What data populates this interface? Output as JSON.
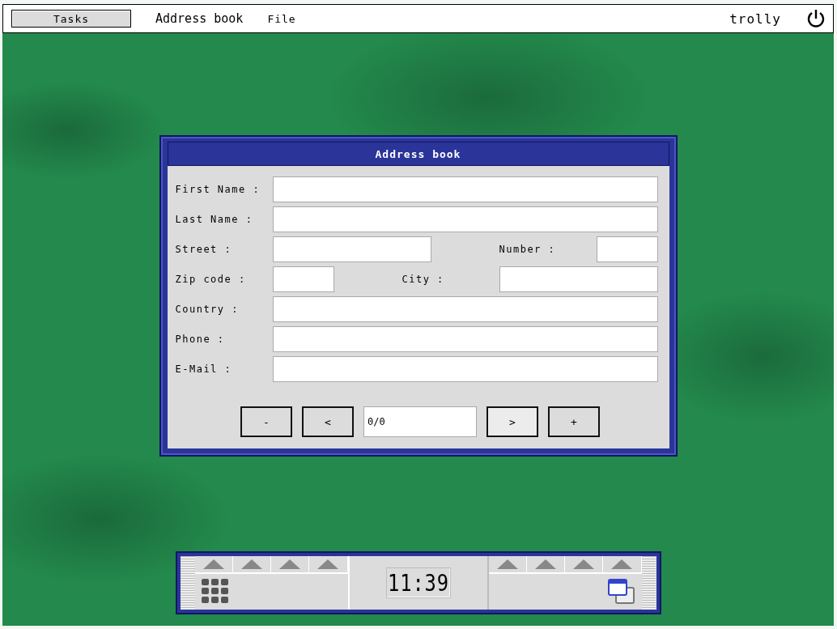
{
  "menu_bar": {
    "tasks_button": "Tasks",
    "app_name": "Address book",
    "menus": [
      "File"
    ],
    "user": "trolly"
  },
  "window": {
    "title": "Address book",
    "rows": [
      {
        "fields": [
          {
            "label": "First Name :",
            "kind": "full"
          }
        ]
      },
      {
        "fields": [
          {
            "label": "Last Name :",
            "kind": "full"
          }
        ]
      },
      {
        "fields": [
          {
            "label": "Street :",
            "kind": "medium"
          },
          {
            "label": "Number :",
            "kind": "small"
          }
        ]
      },
      {
        "fields": [
          {
            "label": "Zip code :",
            "kind": "small"
          },
          {
            "label": "City :",
            "kind": "medium"
          }
        ]
      },
      {
        "fields": [
          {
            "label": "Country :",
            "kind": "full"
          }
        ]
      },
      {
        "fields": [
          {
            "label": "Phone :",
            "kind": "full"
          }
        ]
      },
      {
        "fields": [
          {
            "label": "E-Mail :",
            "kind": "full"
          }
        ]
      }
    ],
    "navigation": [
      {
        "kind": "button",
        "label": "-",
        "hovered": false
      },
      {
        "kind": "button",
        "label": "<",
        "hovered": false
      },
      {
        "kind": "counter",
        "label": "0/0"
      },
      {
        "kind": "button",
        "label": ">",
        "hovered": true
      },
      {
        "kind": "button",
        "label": "+",
        "hovered": false
      }
    ]
  },
  "dock": {
    "clock": "11:39"
  }
}
